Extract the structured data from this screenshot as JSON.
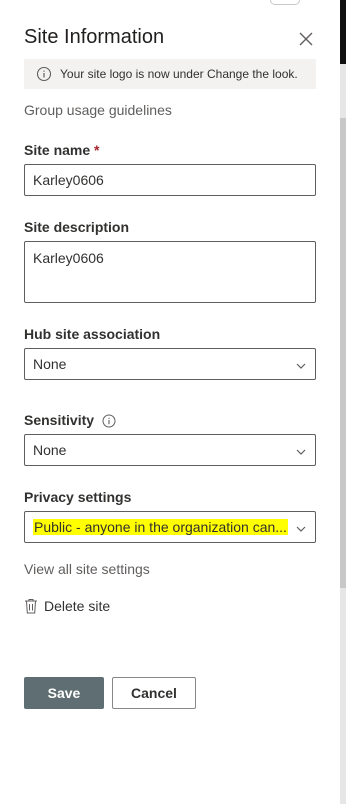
{
  "panel": {
    "title": "Site Information",
    "info_message": "Your site logo is now under Change the look.",
    "group_usage_link": "Group usage guidelines"
  },
  "site_name": {
    "label": "Site name",
    "required_marker": "*",
    "value": "Karley0606"
  },
  "site_description": {
    "label": "Site description",
    "value": "Karley0606"
  },
  "hub_site": {
    "label": "Hub site association",
    "value": "None"
  },
  "sensitivity": {
    "label": "Sensitivity",
    "value": "None"
  },
  "privacy": {
    "label": "Privacy settings",
    "value": "Public - anyone in the organization can..."
  },
  "links": {
    "view_all": "View all site settings",
    "delete_site": "Delete site"
  },
  "buttons": {
    "save": "Save",
    "cancel": "Cancel"
  },
  "colors": {
    "highlight": "#ffff00",
    "save_bg": "#5f6e72",
    "required": "#a4262c"
  },
  "icons": [
    "close-icon",
    "info-icon",
    "chevron-down-icon",
    "trash-icon"
  ]
}
